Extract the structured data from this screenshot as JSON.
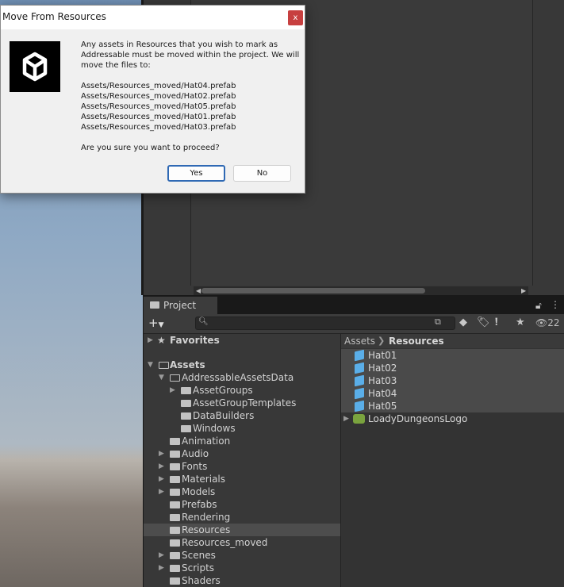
{
  "dialog": {
    "title": "Move From Resources",
    "close_label": "x",
    "message_1": "Any assets in Resources that you wish to mark as",
    "message_2": "Addressable must be moved within the project. We will",
    "message_3": "move the files to:",
    "paths": [
      "Assets/Resources_moved/Hat04.prefab",
      "Assets/Resources_moved/Hat02.prefab",
      "Assets/Resources_moved/Hat05.prefab",
      "Assets/Resources_moved/Hat01.prefab",
      "Assets/Resources_moved/Hat03.prefab"
    ],
    "question": "Are you sure you want to proceed?",
    "yes_label": "Yes",
    "no_label": "No"
  },
  "project": {
    "tab_label": "Project",
    "search_placeholder": "",
    "visible_count": "22",
    "tree": {
      "favorites": "Favorites",
      "assets": "Assets",
      "items": [
        "AddressableAssetsData",
        "AssetGroups",
        "AssetGroupTemplates",
        "DataBuilders",
        "Windows",
        "Animation",
        "Audio",
        "Fonts",
        "Materials",
        "Models",
        "Prefabs",
        "Rendering",
        "Resources",
        "Resources_moved",
        "Scenes",
        "Scripts",
        "Shaders"
      ]
    },
    "breadcrumb": {
      "root": "Assets",
      "current": "Resources"
    },
    "files": [
      "Hat01",
      "Hat02",
      "Hat03",
      "Hat04",
      "Hat05",
      "LoadyDungeonsLogo"
    ]
  },
  "colors": {
    "accent": "#2f69b4",
    "prefab_icon": "#5aaee8",
    "close_button": "#c74040"
  },
  "icons": {
    "add": "plus-icon",
    "search": "search-icon",
    "lock": "lock-icon",
    "menu": "kebab-menu-icon",
    "eye": "eye-icon"
  }
}
